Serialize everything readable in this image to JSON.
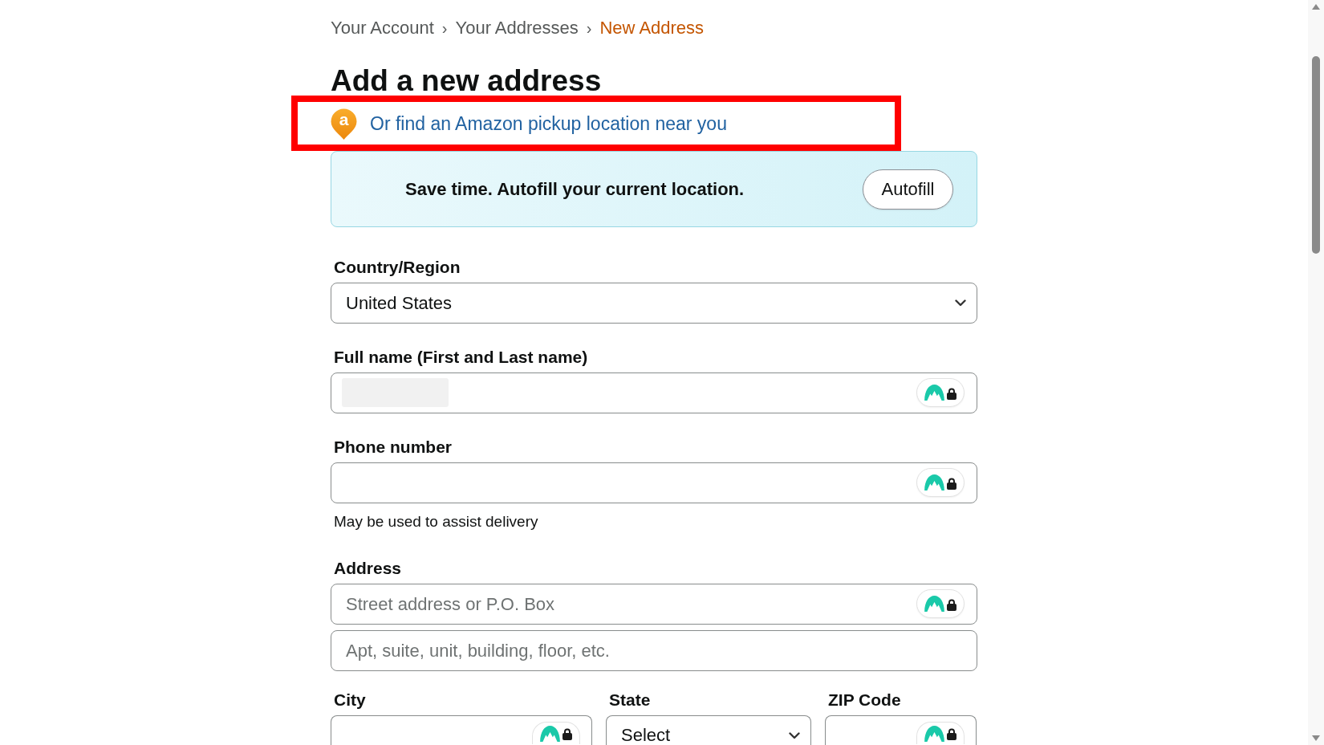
{
  "breadcrumb": [
    {
      "label": "Your Account",
      "current": false,
      "separator": "›"
    },
    {
      "label": "Your Addresses",
      "current": false,
      "separator": "›"
    },
    {
      "label": "New Address",
      "current": true
    }
  ],
  "title": "Add a new address",
  "pickup_link": {
    "pin_letter": "a",
    "text": "Or find an Amazon pickup location near you",
    "highlighted": true
  },
  "autofill_banner": {
    "text": "Save time. Autofill your current location.",
    "button": "Autofill"
  },
  "form": {
    "fields": [
      {
        "kind": "select",
        "label": "Country/Region",
        "value": "United States"
      },
      {
        "kind": "text",
        "label": "Full name (First and Last name)",
        "redacted": true,
        "lock_badge": true
      },
      {
        "kind": "text",
        "label": "Phone number",
        "lock_badge": true,
        "hint": "May be used to assist delivery"
      },
      {
        "kind": "address",
        "label": "Address",
        "lines": [
          {
            "placeholder": "Street address or P.O. Box",
            "lock_badge": true
          },
          {
            "placeholder": "Apt, suite, unit, building, floor, etc.",
            "lock_badge": false
          }
        ]
      },
      {
        "kind": "row",
        "fields": [
          {
            "kind": "text",
            "label": "City",
            "lock_badge": true
          },
          {
            "kind": "select",
            "label": "State",
            "value": "Select"
          },
          {
            "kind": "text",
            "label": "ZIP Code",
            "lock_badge": true
          }
        ]
      }
    ]
  }
}
